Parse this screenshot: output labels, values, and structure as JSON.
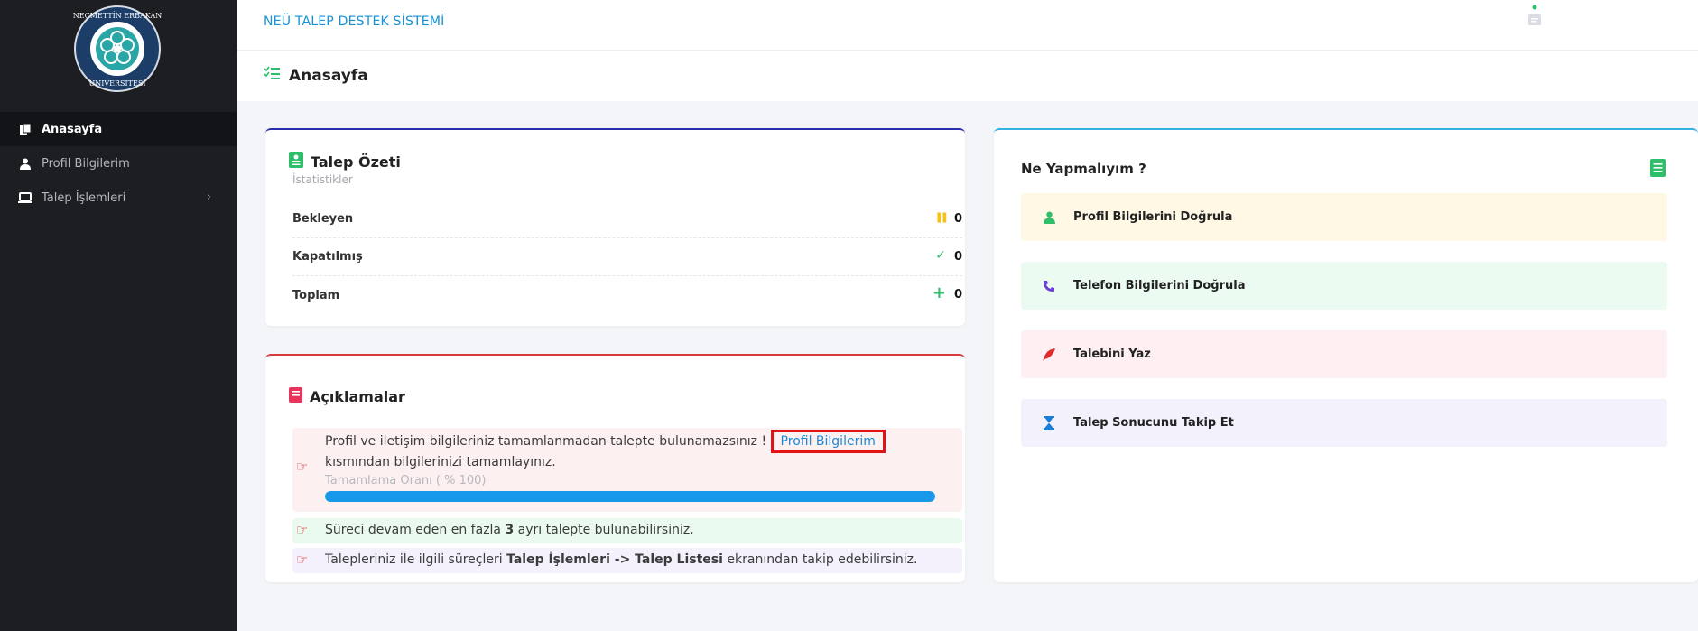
{
  "app": {
    "title": "NEÜ TALEP DESTEK SİSTEMİ"
  },
  "page": {
    "title": "Anasayfa"
  },
  "sidebar": {
    "items": [
      {
        "label": "Anasayfa",
        "icon": "copy-icon",
        "active": true
      },
      {
        "label": "Profil Bilgilerim",
        "icon": "user-icon",
        "active": false
      },
      {
        "label": "Talep İşlemleri",
        "icon": "laptop-icon",
        "active": false,
        "chevron": "›"
      }
    ]
  },
  "summary": {
    "title": "Talep Özeti",
    "subtitle": "İstatistikler",
    "rows": [
      {
        "label": "Bekleyen",
        "icon": "pause-icon",
        "icon_glyph": "❚❚",
        "icon_color": "#f4c21a",
        "value": "0"
      },
      {
        "label": "Kapatılmış",
        "icon": "check-icon",
        "icon_glyph": "✓",
        "icon_color": "#2fbf6a",
        "value": "0"
      },
      {
        "label": "Toplam",
        "icon": "plus-icon",
        "icon_glyph": "+",
        "icon_color": "#2fbf6a",
        "value": "0"
      }
    ]
  },
  "notes": {
    "title": "Açıklamalar",
    "note1": {
      "text_before": "Profil ve iletişim bilgileriniz tamamlanmadan talepte bulunamazsınız !",
      "link": "Profil Bilgilerim",
      "text_after": "kısmından bilgilerinizi tamamlayınız.",
      "progress_label": "Tamamlama Oranı ( % 100)",
      "progress_percent": 100
    },
    "note2": {
      "before": "Süreci devam eden en fazla ",
      "bold": "3",
      "after": " ayrı talepte bulunabilirsiniz."
    },
    "note3": {
      "before": "Talepleriniz ile ilgili süreçleri ",
      "bold": "Talep İşlemleri -> Talep Listesi",
      "after": " ekranından takip edebilirsiniz."
    }
  },
  "todo": {
    "title": "Ne Yapmalıyım ?",
    "items": [
      {
        "label": "Profil Bilgilerini Doğrula",
        "icon": "user-icon",
        "bg": "#fff8e5",
        "color": "#2fbf6a"
      },
      {
        "label": "Telefon Bilgilerini Doğrula",
        "icon": "phone-icon",
        "bg": "#ebfbf1",
        "color": "#6a3fd8"
      },
      {
        "label": "Talebini Yaz",
        "icon": "feather-icon",
        "bg": "#fef0f2",
        "color": "#e02c2c"
      },
      {
        "label": "Talep Sonucunu Takip Et",
        "icon": "hourglass-icon",
        "bg": "#f3f1fb",
        "color": "#1b7fd6"
      }
    ]
  },
  "colors": {
    "accent": "#1592d8",
    "sidebar_bg": "#1d1e22",
    "danger": "#e02c2c"
  }
}
